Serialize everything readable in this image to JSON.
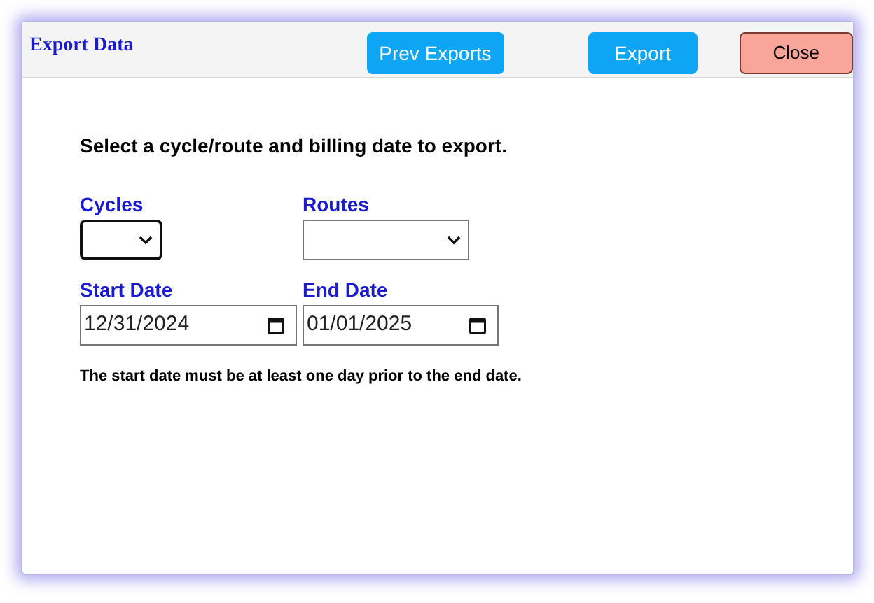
{
  "dialog": {
    "title": "Export Data",
    "buttons": [
      {
        "kind": "primary",
        "label": "Prev Exports"
      },
      {
        "kind": "primary",
        "label": "Export"
      },
      {
        "kind": "danger",
        "label": "Close"
      }
    ]
  },
  "instruction": "Select a cycle/route and billing date to export.",
  "fields": [
    {
      "kind": "select",
      "label": "Cycles",
      "focused": true
    },
    {
      "kind": "select",
      "label": "Routes",
      "focused": false
    },
    {
      "kind": "date",
      "label": "Start Date",
      "value": "12/31/2024",
      "focused": false
    },
    {
      "kind": "date",
      "label": "End Date",
      "value": "01/01/2025",
      "focused": false
    }
  ],
  "note": "The start date must be at least one day prior to the end date."
}
